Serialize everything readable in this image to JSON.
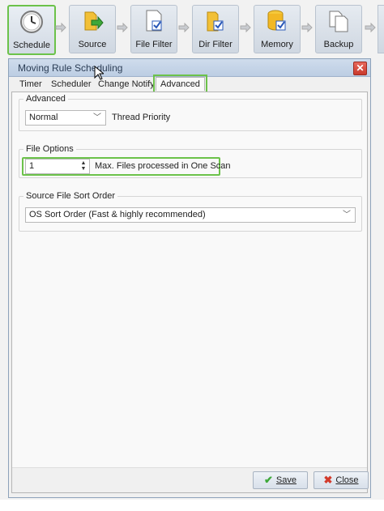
{
  "toolbar": {
    "steps": [
      {
        "label": "Schedule",
        "icon": "clock-icon"
      },
      {
        "label": "Source",
        "icon": "folder-arrow-icon"
      },
      {
        "label": "File Filter",
        "icon": "file-check-icon"
      },
      {
        "label": "Dir Filter",
        "icon": "folder-check-icon"
      },
      {
        "label": "Memory",
        "icon": "database-check-icon"
      },
      {
        "label": "Backup",
        "icon": "copy-icon"
      }
    ]
  },
  "dialog": {
    "title": "Moving Rule Scheduling",
    "close_label": "✕",
    "tabs": [
      "Timer",
      "Scheduler",
      "Change Notify",
      "Advanced"
    ],
    "active_tab": "Advanced",
    "advanced": {
      "legend": "Advanced",
      "priority_value": "Normal",
      "priority_label": "Thread Priority"
    },
    "file_options": {
      "legend": "File Options",
      "max_files_value": "1",
      "max_files_label": "Max. Files processed in One Scan"
    },
    "sort_order": {
      "legend": "Source File Sort Order",
      "value": "OS Sort Order (Fast & highly recommended)"
    },
    "buttons": {
      "save": "Save",
      "close": "Close"
    }
  },
  "colors": {
    "highlight": "#6cc24a",
    "titlebar": "#bccde3",
    "close_red": "#c9392c"
  }
}
